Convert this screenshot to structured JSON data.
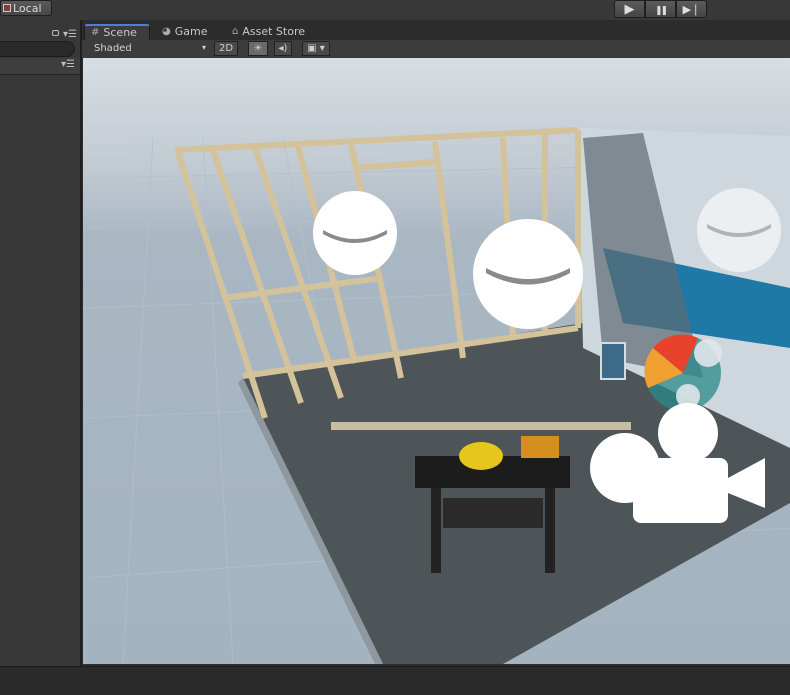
{
  "toolbar": {
    "pivot_label": "Local",
    "play_icons": [
      "▶",
      "❚❚",
      "▶❘"
    ]
  },
  "tabs": {
    "scene_label": "Scene",
    "game_label": "Game",
    "asset_store_label": "Asset Store"
  },
  "scene_toolbar": {
    "shading_mode": "Shaded",
    "mode_2d_label": "2D"
  },
  "icons": {
    "scene_tab": "scene-grid-icon",
    "game_tab": "game-pacman-icon",
    "asset_tab": "asset-store-bag-icon",
    "lighting": "sun-icon",
    "audio": "speaker-icon",
    "effects": "image-icon",
    "camera_gizmo": "camera-icon",
    "light_probe": "light-gizmo-icon"
  },
  "colors": {
    "active_tab_accent": "#4c7de3",
    "editor_background": "#383838",
    "scene_sky": "#c2cad2"
  }
}
